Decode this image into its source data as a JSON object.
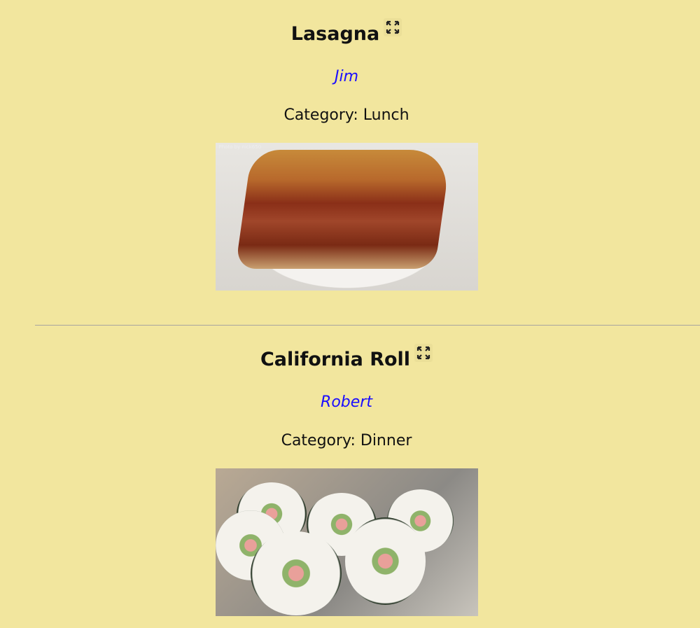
{
  "recipes": [
    {
      "title": "Lasagna",
      "author": "Jim",
      "category": "Category: Lunch",
      "photo_credit": "Photo by nick650",
      "expand_icon": "expand-icon"
    },
    {
      "title": "California Roll",
      "author": "Robert",
      "category": "Category: Dinner",
      "expand_icon": "expand-icon"
    }
  ],
  "colors": {
    "background": "#f2e69e",
    "author_link": "#1a0dff"
  }
}
